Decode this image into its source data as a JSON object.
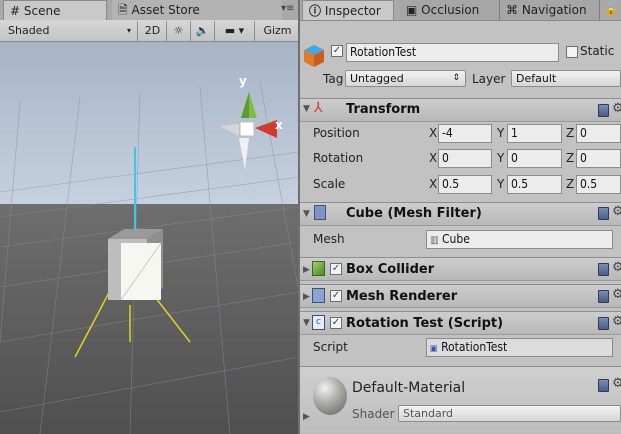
{
  "scene_panel": {
    "tab_scene": "Scene",
    "tab_asset_store": "Asset Store",
    "shading_mode": "Shaded",
    "btn_2d": "2D",
    "gizmos_label": "Gizm",
    "gizmo_axes": {
      "y": "y",
      "x": "x"
    }
  },
  "inspector": {
    "tab_inspector": "Inspector",
    "tab_occlusion": "Occlusion",
    "tab_navigation": "Navigation",
    "object_name": "RotationTest",
    "static_label": "Static",
    "tag_label": "Tag",
    "tag_value": "Untagged",
    "layer_label": "Layer",
    "layer_value": "Default",
    "transform": {
      "title": "Transform",
      "position_label": "Position",
      "rotation_label": "Rotation",
      "scale_label": "Scale",
      "x_label": "X",
      "y_label": "Y",
      "z_label": "Z",
      "position": {
        "x": "-4",
        "y": "1",
        "z": "0"
      },
      "rotation": {
        "x": "0",
        "y": "0",
        "z": "0"
      },
      "scale": {
        "x": "0.5",
        "y": "0.5",
        "z": "0.5"
      }
    },
    "mesh_filter": {
      "title": "Cube (Mesh Filter)",
      "mesh_label": "Mesh",
      "mesh_value": "Cube"
    },
    "box_collider": {
      "title": "Box Collider"
    },
    "mesh_renderer": {
      "title": "Mesh Renderer"
    },
    "rotation_script": {
      "title": "Rotation Test (Script)",
      "script_label": "Script",
      "script_value": "RotationTest"
    },
    "material": {
      "name": "Default-Material",
      "shader_label": "Shader",
      "shader_value": "Standard"
    }
  },
  "colors": {
    "sky": "#b9c7db",
    "ground": "#5f5f5f",
    "x_axis": "#d23b2b",
    "y_axis": "#7cc043",
    "selection": "#3ea7e8",
    "bound": "#e5d21d"
  }
}
